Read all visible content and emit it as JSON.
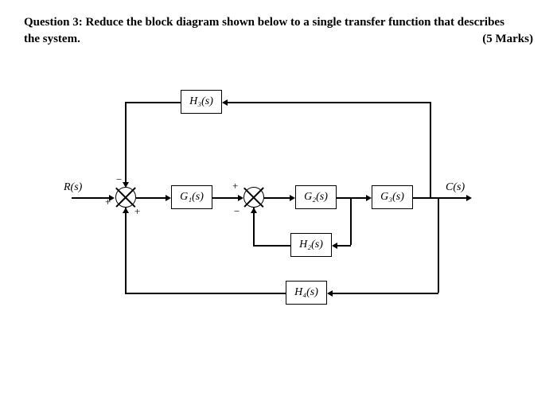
{
  "question": {
    "prefix": "Question 3:",
    "text": "Reduce the block diagram shown below to a single transfer function that describes",
    "line2": "the system.",
    "marks": "(5 Marks)"
  },
  "diagram": {
    "input_label": "R(s)",
    "output_label": "C(s)",
    "blocks": {
      "H3": "H₃(s)",
      "G1": "G₁(s)",
      "G2": "G₂(s)",
      "G3": "G₃(s)",
      "H2": "H₂(s)",
      "H4": "H₄(s)"
    },
    "signs": {
      "sum1_top": "−",
      "sum1_left": "+",
      "sum1_bottom": "+",
      "sum2_top": "+",
      "sum2_bottom": "−"
    }
  }
}
